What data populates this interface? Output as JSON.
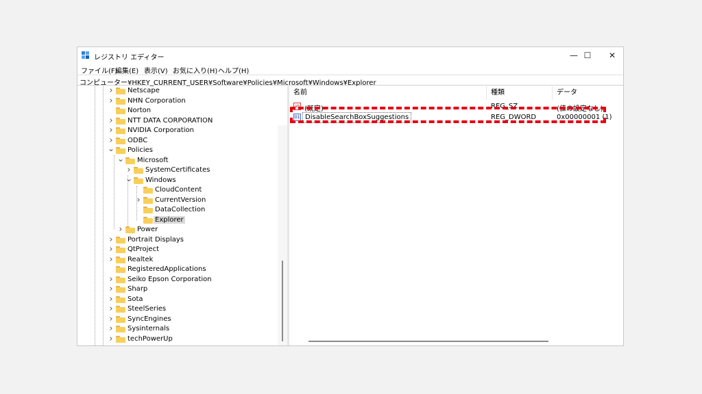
{
  "window": {
    "title": "レジストリ エディター",
    "controls": {
      "minimize": "—",
      "maximize": "☐",
      "close": "✕"
    }
  },
  "menu": [
    "ファイル(F)",
    "編集(E)",
    "表示(V)",
    "お気に入り(H)",
    "ヘルプ(H)"
  ],
  "address": "コンピューター¥HKEY_CURRENT_USER¥Software¥Policies¥Microsoft¥Windows¥Explorer",
  "tree": {
    "nodes": [
      {
        "label": "Netscape",
        "level": 0,
        "expander": ">"
      },
      {
        "label": "NHN Corporation",
        "level": 0,
        "expander": ">"
      },
      {
        "label": "Norton",
        "level": 0,
        "expander": ""
      },
      {
        "label": "NTT DATA CORPORATION",
        "level": 0,
        "expander": ">"
      },
      {
        "label": "NVIDIA Corporation",
        "level": 0,
        "expander": ">"
      },
      {
        "label": "ODBC",
        "level": 0,
        "expander": ">"
      },
      {
        "label": "Policies",
        "level": 0,
        "expander": "v"
      },
      {
        "label": "Microsoft",
        "level": 1,
        "expander": "v"
      },
      {
        "label": "SystemCertificates",
        "level": 2,
        "expander": ">"
      },
      {
        "label": "Windows",
        "level": 2,
        "expander": "v"
      },
      {
        "label": "CloudContent",
        "level": 3,
        "expander": ""
      },
      {
        "label": "CurrentVersion",
        "level": 3,
        "expander": ">"
      },
      {
        "label": "DataCollection",
        "level": 3,
        "expander": ""
      },
      {
        "label": "Explorer",
        "level": 3,
        "expander": "",
        "selected": true
      },
      {
        "label": "Power",
        "level": 1,
        "expander": ">"
      },
      {
        "label": "Portrait Displays",
        "level": 0,
        "expander": ">"
      },
      {
        "label": "QtProject",
        "level": 0,
        "expander": ">"
      },
      {
        "label": "Realtek",
        "level": 0,
        "expander": ">"
      },
      {
        "label": "RegisteredApplications",
        "level": 0,
        "expander": ""
      },
      {
        "label": "Seiko Epson Corporation",
        "level": 0,
        "expander": ">"
      },
      {
        "label": "Sharp",
        "level": 0,
        "expander": ">"
      },
      {
        "label": "Sota",
        "level": 0,
        "expander": ">"
      },
      {
        "label": "SteelSeries",
        "level": 0,
        "expander": ">"
      },
      {
        "label": "SyncEngines",
        "level": 0,
        "expander": ">"
      },
      {
        "label": "Sysinternals",
        "level": 0,
        "expander": ">"
      },
      {
        "label": "techPowerUp",
        "level": 0,
        "expander": ">"
      }
    ]
  },
  "list": {
    "columns": [
      "名前",
      "種類",
      "データ"
    ],
    "rows": [
      {
        "icon": "string-value-icon",
        "name": "(既定)",
        "type": "REG_SZ",
        "data": "(値の設定なし)"
      },
      {
        "icon": "dword-value-icon",
        "name": "DisableSearchBoxSuggestions",
        "type": "REG_DWORD",
        "data": "0x00000001 (1)"
      }
    ]
  },
  "colors": {
    "highlight_border": "#e60012",
    "folder": "#f8cf5a",
    "selection": "#d9d9d9"
  }
}
